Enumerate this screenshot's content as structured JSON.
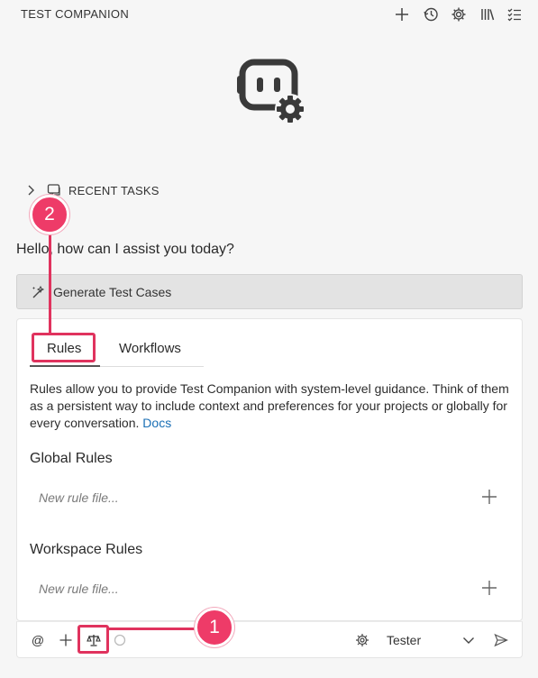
{
  "header": {
    "title": "TEST COMPANION",
    "icons": [
      "plus-icon",
      "history-icon",
      "gear-icon",
      "library-icon",
      "checklist-icon"
    ]
  },
  "logo": {
    "icon": "robot-gear-icon"
  },
  "recent_tasks": {
    "label": "RECENT TASKS"
  },
  "greeting": "Hello, how can I assist you today?",
  "generate_button": {
    "label": "Generate Test Cases"
  },
  "tabs": [
    {
      "label": "Rules",
      "active": true
    },
    {
      "label": "Workflows",
      "active": false
    }
  ],
  "rules_panel": {
    "description": "Rules allow you to provide Test Companion with system-level guidance. Think of them as a persistent way to include context and preferences for your projects or globally for every conversation.",
    "docs_link": "Docs",
    "global_title": "Global Rules",
    "global_placeholder": "New rule file...",
    "workspace_title": "Workspace Rules",
    "workspace_placeholder": "New rule file..."
  },
  "bottom_bar": {
    "at_label": "@",
    "mode_label": "Tester",
    "icons": [
      "at-icon",
      "plus-icon",
      "scale-icon",
      "circle-icon",
      "gear-icon",
      "chevron-down-icon",
      "send-icon"
    ]
  },
  "annotations": {
    "badge_1": "1",
    "badge_2": "2",
    "accent": "#e0335e"
  }
}
